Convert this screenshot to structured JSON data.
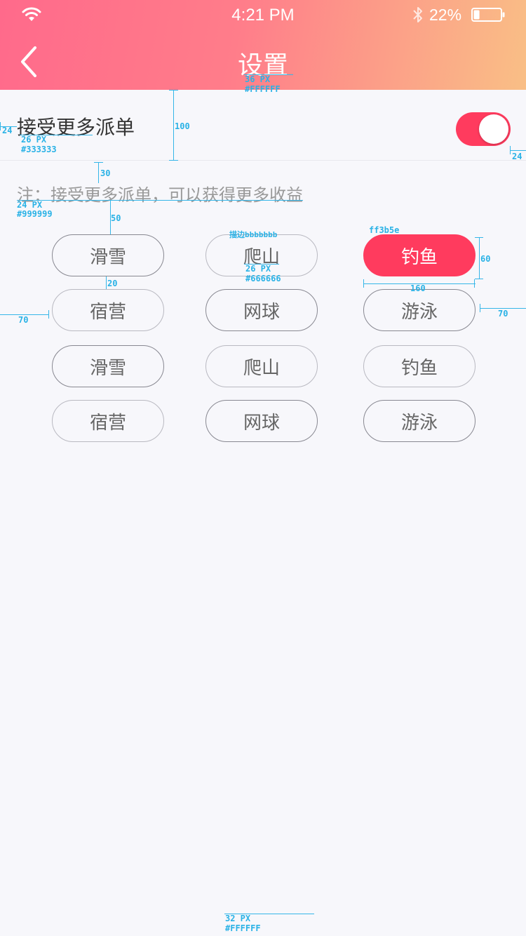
{
  "status_bar": {
    "time": "4:21 PM",
    "battery_percent": "22%",
    "battery_level": 0.22
  },
  "header": {
    "title": "设置"
  },
  "setting": {
    "label": "接受更多派单",
    "toggle_on": true
  },
  "note": "注：接受更多派单，可以获得更多收益",
  "chips": [
    {
      "label": "滑雪",
      "selected": false
    },
    {
      "label": "爬山",
      "selected": false
    },
    {
      "label": "钓鱼",
      "selected": true
    },
    {
      "label": "宿营",
      "selected": false
    },
    {
      "label": "网球",
      "selected": false
    },
    {
      "label": "游泳",
      "selected": false
    },
    {
      "label": "滑雪",
      "selected": false
    },
    {
      "label": "爬山",
      "selected": false
    },
    {
      "label": "钓鱼",
      "selected": false
    },
    {
      "label": "宿营",
      "selected": false
    },
    {
      "label": "网球",
      "selected": false
    },
    {
      "label": "游泳",
      "selected": false
    }
  ],
  "colors": {
    "accent": "#ff3b5e",
    "header_gradient_start": "#ff6a8b",
    "header_gradient_end": "#f9bf86",
    "text_primary": "#333333",
    "text_secondary": "#999999",
    "chip_text": "#666666",
    "background": "#f7f7fb"
  },
  "annotations": {
    "title_spec": "36 PX",
    "title_color": "#FFFFFF",
    "label_size": "26 PX",
    "label_color": "#333333",
    "note_size": "24 PX",
    "note_color": "#999999",
    "chip_size": "26 PX",
    "chip_color": "#666666",
    "stroke_note": "描边bbbbbbb",
    "accent_hex": "ff3b5e",
    "bottom_size": "32 PX",
    "bottom_color": "#FFFFFF",
    "m24": "24",
    "m100": "100",
    "m30": "30",
    "m50": "50",
    "m20": "20",
    "m60": "60",
    "m160": "160",
    "m70": "70",
    "m24b": "24",
    "m70b": "70"
  }
}
